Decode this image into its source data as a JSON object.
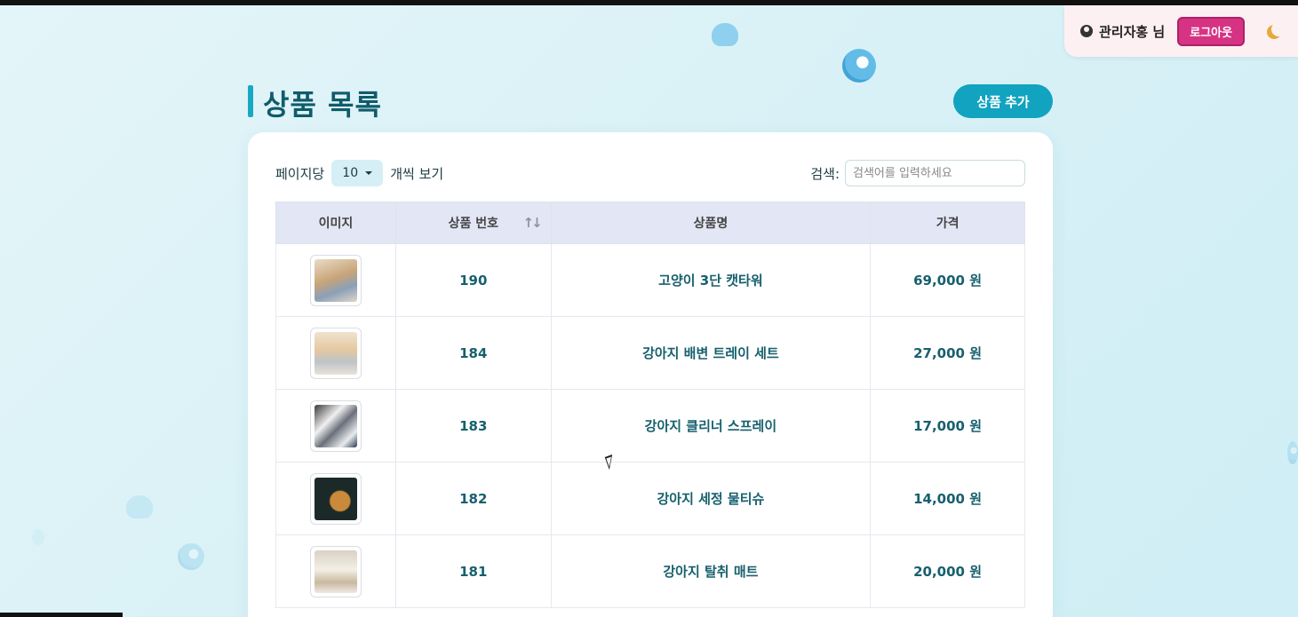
{
  "user": {
    "name": "관리자홍 님",
    "logout_label": "로그아웃",
    "theme_icon": "moon-icon"
  },
  "header": {
    "title": "상품 목록",
    "add_button_label": "상품 추가"
  },
  "controls": {
    "per_page_prefix": "페이지당",
    "per_page_value": "10",
    "per_page_suffix": "개씩 보기",
    "search_label": "검색:",
    "search_placeholder": "검색어를 입력하세요"
  },
  "table": {
    "columns": [
      "이미지",
      "상품 번호",
      "상품명",
      "가격"
    ],
    "rows": [
      {
        "no": "190",
        "name": "고양이 3단 캣타워",
        "price": "69,000 원"
      },
      {
        "no": "184",
        "name": "강아지 배변 트레이 세트",
        "price": "27,000 원"
      },
      {
        "no": "183",
        "name": "강아지 클리너 스프레이",
        "price": "17,000 원"
      },
      {
        "no": "182",
        "name": "강아지 세정 물티슈",
        "price": "14,000 원"
      },
      {
        "no": "181",
        "name": "강아지 탈취 매트",
        "price": "20,000 원"
      }
    ]
  },
  "colors": {
    "accent": "#11a3bf",
    "title": "#0f5c6b",
    "logout": "#d63384"
  }
}
